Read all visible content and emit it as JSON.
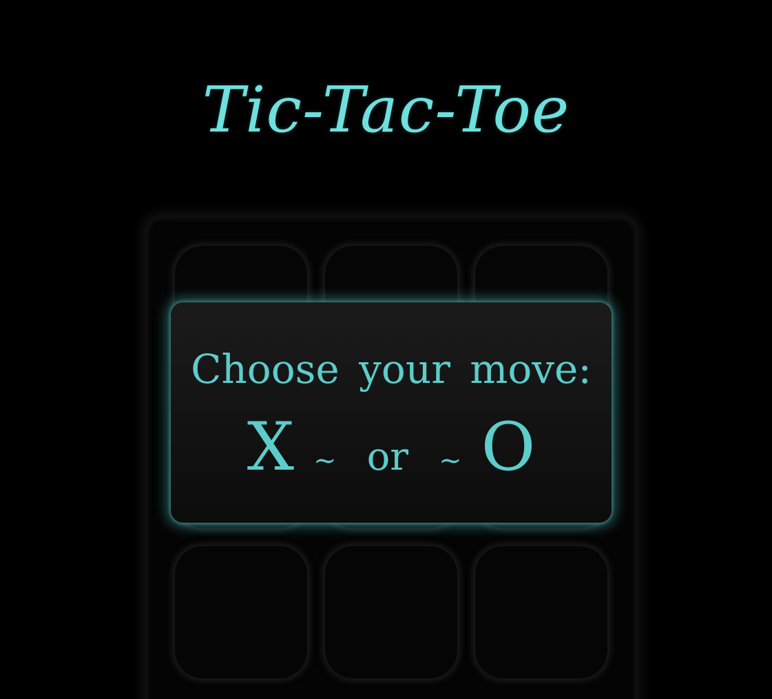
{
  "title": "Tic-Tac-Toe",
  "modal": {
    "prompt": "Choose your move:",
    "choice_x": "X",
    "tilde_left": "~",
    "or_text": "or",
    "tilde_right": "~",
    "choice_o": "O"
  },
  "board": {
    "cells": [
      "",
      "",
      "",
      "",
      "",
      "",
      "",
      "",
      ""
    ]
  },
  "colors": {
    "accent": "#5ccdcb",
    "title": "#6ee0de",
    "background": "#000000"
  }
}
